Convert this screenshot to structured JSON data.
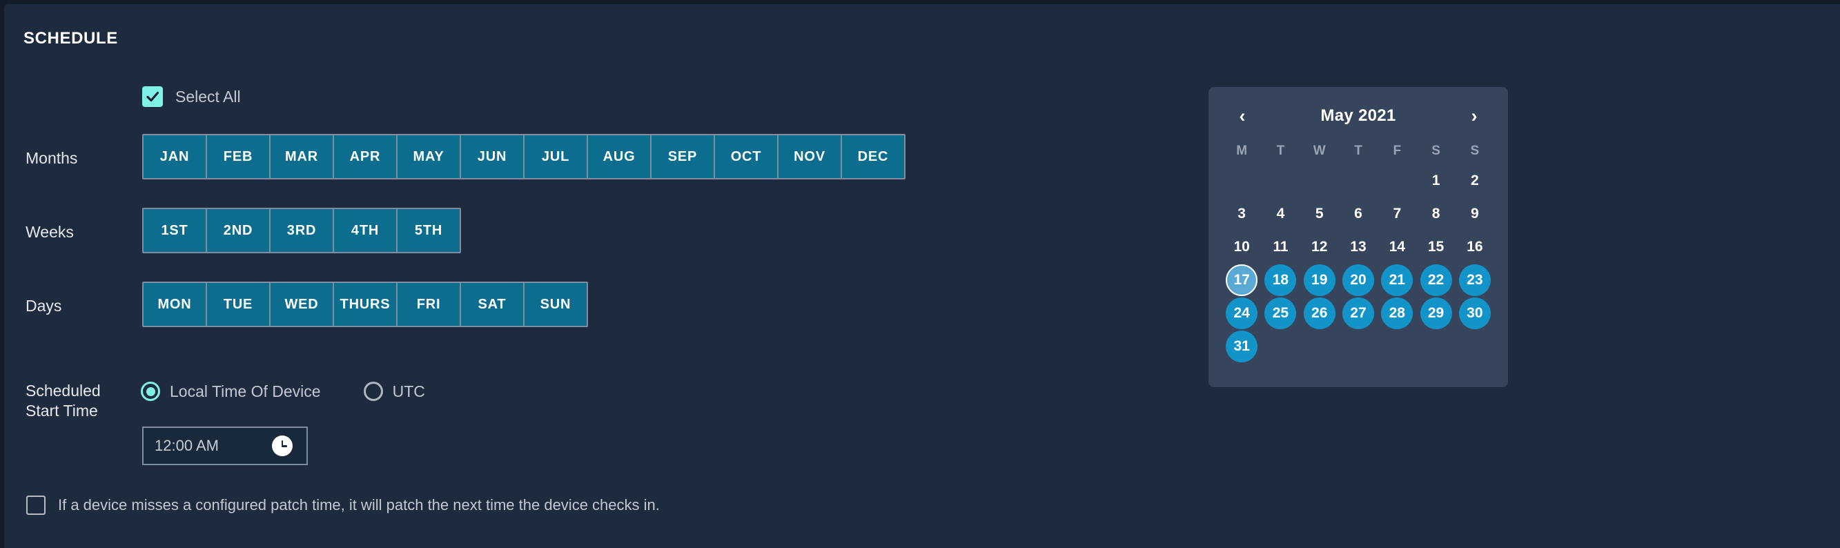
{
  "section": {
    "title": "SCHEDULE"
  },
  "select_all": {
    "label": "Select All",
    "checked": true,
    "icon": "check-icon"
  },
  "rows": {
    "months": {
      "label": "Months",
      "items": [
        "JAN",
        "FEB",
        "MAR",
        "APR",
        "MAY",
        "JUN",
        "JUL",
        "AUG",
        "SEP",
        "OCT",
        "NOV",
        "DEC"
      ]
    },
    "weeks": {
      "label": "Weeks",
      "items": [
        "1ST",
        "2ND",
        "3RD",
        "4TH",
        "5TH"
      ]
    },
    "days": {
      "label": "Days",
      "items": [
        "MON",
        "TUE",
        "WED",
        "THURS",
        "FRI",
        "SAT",
        "SUN"
      ]
    }
  },
  "scheduled_start_time": {
    "label": "Scheduled\nStart Time",
    "label_line1": "Scheduled",
    "label_line2": "Start Time",
    "options": [
      {
        "label": "Local Time Of Device",
        "selected": true
      },
      {
        "label": "UTC",
        "selected": false
      }
    ],
    "time_value": "12:00 AM",
    "time_icon": "clock-icon"
  },
  "miss_patch": {
    "label": "If a device misses a configured patch time, it will patch the next time the device checks in.",
    "checked": false
  },
  "calendar": {
    "title": "May 2021",
    "prev_icon": "chevron-left-icon",
    "next_icon": "chevron-right-icon",
    "prev_glyph": "‹",
    "next_glyph": "›",
    "dow": [
      "M",
      "T",
      "W",
      "T",
      "F",
      "S",
      "S"
    ],
    "leading_blanks": 5,
    "days": [
      1,
      2,
      3,
      4,
      5,
      6,
      7,
      8,
      9,
      10,
      11,
      12,
      13,
      14,
      15,
      16,
      17,
      18,
      19,
      20,
      21,
      22,
      23,
      24,
      25,
      26,
      27,
      28,
      29,
      30,
      31
    ],
    "selected_days": [
      17,
      18,
      19,
      20,
      21,
      22,
      23,
      24,
      25,
      26,
      27,
      28,
      29,
      30,
      31
    ],
    "today": 17
  },
  "colors": {
    "page_bg": "#1e2a3d",
    "outer_bg": "#151c29",
    "segment_fill": "#0c6d8e",
    "segment_border": "#7d8ea3",
    "accent_aqua": "#7ef2e4",
    "calendar_bg": "#36445c",
    "day_selected": "#1294c9",
    "day_today": "#5aa9d4",
    "text_primary": "#ffffff",
    "text_muted": "#c3c9d2"
  }
}
